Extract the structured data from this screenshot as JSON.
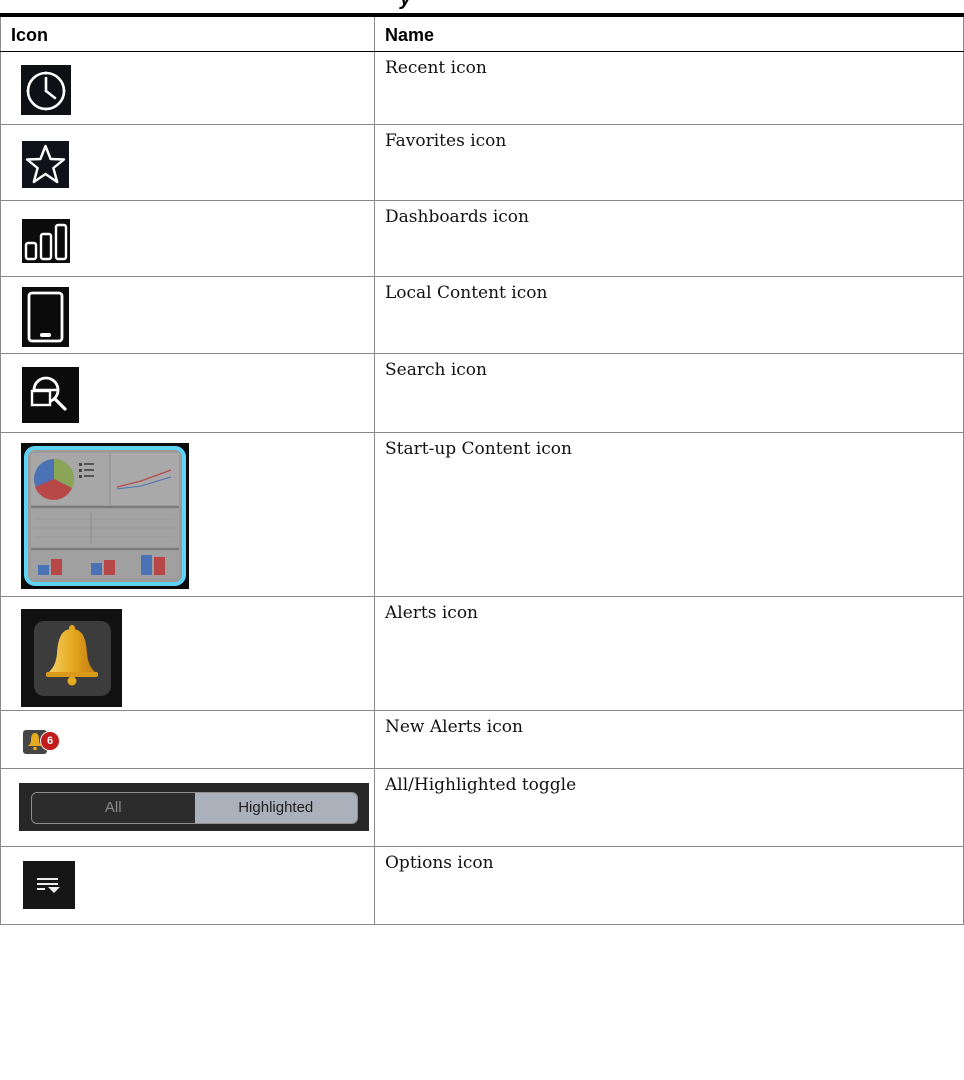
{
  "header": {
    "cut_title": "y",
    "col_icon": "Icon",
    "col_name": "Name"
  },
  "rows": [
    {
      "icon": "recent-icon",
      "name": "Recent icon"
    },
    {
      "icon": "star-icon",
      "name": "Favorites icon"
    },
    {
      "icon": "bar-chart-icon",
      "name": "Dashboards icon"
    },
    {
      "icon": "tablet-icon",
      "name": "Local Content icon"
    },
    {
      "icon": "search-icon",
      "name": "Search icon"
    },
    {
      "icon": "dashboard-thumbnail-icon",
      "name": "Start-up Content icon"
    },
    {
      "icon": "bell-icon",
      "name": "Alerts icon"
    },
    {
      "icon": "bell-badge-icon",
      "name": "New Alerts icon",
      "badge": "6"
    },
    {
      "icon": "toggle-control",
      "name": "All/Highlighted toggle",
      "toggle": {
        "left": "All",
        "right": "Highlighted"
      }
    },
    {
      "icon": "options-icon",
      "name": "Options icon"
    }
  ],
  "colors": {
    "icon_bg": "#0b0b0b",
    "highlight": "#5fd3f3",
    "bell": "#e6a91f",
    "badge": "#c21b1b"
  }
}
